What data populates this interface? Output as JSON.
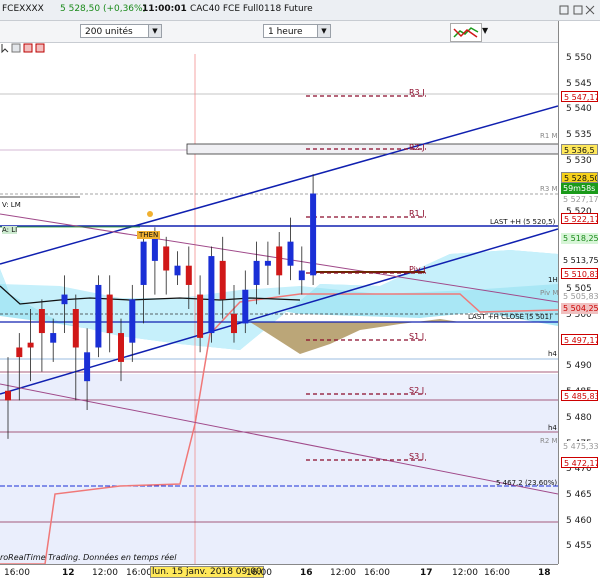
{
  "header": {
    "symbol": "FCEXXXX",
    "price_change": "5 528,50 (+0,36%)",
    "time": "11:00:01",
    "instrument": "CAC40 FCE Full0118 Future"
  },
  "toolbar": {
    "units": "200 unités",
    "interval": "1 heure"
  },
  "indicator_labels": {
    "v_lm": "V: LM",
    "a_l": "A: LI",
    "then": "THEN"
  },
  "levels": [
    {
      "name": "R3 J",
      "price_label": "5 547,17"
    },
    {
      "name": "R2 J",
      "price_label": "5 536,5"
    },
    {
      "name": "R1 J",
      "price_label": "5 522,17"
    },
    {
      "name": "Piv J",
      "price_label": "5 510,83"
    },
    {
      "name": "S1 J",
      "price_label": "5 497,17"
    },
    {
      "name": "S2 J",
      "price_label": "5 485,83"
    },
    {
      "name": "S3 J",
      "price_label": "5 472,17"
    }
  ],
  "annotations": {
    "last_h": "LAST +H (5 520,5)",
    "last_close": "LAST +H CLOSE (5 501)",
    "fib": "5 467,2 (23,60%)",
    "r1_marker": "R1 M",
    "r2_marker": "R2 M",
    "r3_marker": "R3 M",
    "h1": "1H",
    "h4a": "h4",
    "h4b": "h4",
    "piv_m": "Piv M"
  },
  "y_ticks": [
    "5 550",
    "5 545",
    "5 540",
    "5 535",
    "5 530",
    "5 525",
    "5 520",
    "5 515",
    "5 510",
    "5 505",
    "5 500",
    "5 495",
    "5 490",
    "5 485",
    "5 480",
    "5 475",
    "5 470",
    "5 465",
    "5 460",
    "5 455"
  ],
  "price_labels": {
    "current": "5 528,50",
    "countdown": "59m58s",
    "p5527": "5 527,17",
    "p5518": "5 518,25",
    "p5513": "5 513,75",
    "p5505": "5 505,83",
    "p5504": "5 504,25",
    "p5475": "5 475,33"
  },
  "x_ticks": [
    "16:00",
    "12",
    "12:00",
    "16:00",
    "lun. 15 janv. 2018 09:00",
    "16:00",
    "16",
    "12:00",
    "16:00",
    "17",
    "12:00",
    "16:00",
    "18"
  ],
  "footer": "roRealTime Trading. Données en temps réel",
  "colors": {
    "bull": "#1a2fd6",
    "bear": "#d01818",
    "cloud": "#a9e7f5",
    "channel": "#1020b0",
    "pivot": "#8b0a2a",
    "lower_band": "#f07878",
    "fib_area": "#eaeefc"
  },
  "chart_data": {
    "type": "candlestick",
    "ylim": [
      5452,
      5558
    ],
    "candles": [
      [
        5488,
        5486,
        5478,
        5495
      ],
      [
        5497,
        5495,
        5486,
        5500
      ],
      [
        5498,
        5497,
        5490,
        5505
      ],
      [
        5505,
        5500,
        5492,
        5507
      ],
      [
        5498,
        5500,
        5494,
        5503
      ],
      [
        5506,
        5508,
        5500,
        5512
      ],
      [
        5505,
        5497,
        5486,
        5508
      ],
      [
        5490,
        5496,
        5484,
        5501
      ],
      [
        5497,
        5510,
        5495,
        5512
      ],
      [
        5508,
        5500,
        5496,
        5512
      ],
      [
        5500,
        5494,
        5490,
        5503
      ],
      [
        5498,
        5507,
        5494,
        5510
      ],
      [
        5510,
        5519,
        5502,
        5520
      ],
      [
        5515,
        5520,
        5508,
        5522
      ],
      [
        5518,
        5513,
        5508,
        5520
      ],
      [
        5512,
        5514,
        5510,
        5517
      ],
      [
        5514,
        5510,
        5505,
        5518
      ],
      [
        5508,
        5499,
        5496,
        5512
      ],
      [
        5500,
        5516,
        5498,
        5518
      ],
      [
        5515,
        5507,
        5503,
        5520
      ],
      [
        5504,
        5500,
        5498,
        5510
      ],
      [
        5502,
        5509,
        5500,
        5513
      ],
      [
        5510,
        5515,
        5506,
        5519
      ],
      [
        5514,
        5515,
        5510,
        5519
      ],
      [
        5518,
        5512,
        5508,
        5521
      ],
      [
        5514,
        5519,
        5511,
        5524
      ],
      [
        5511,
        5513,
        5508,
        5518
      ],
      [
        5512,
        5529,
        5510,
        5533
      ]
    ]
  }
}
